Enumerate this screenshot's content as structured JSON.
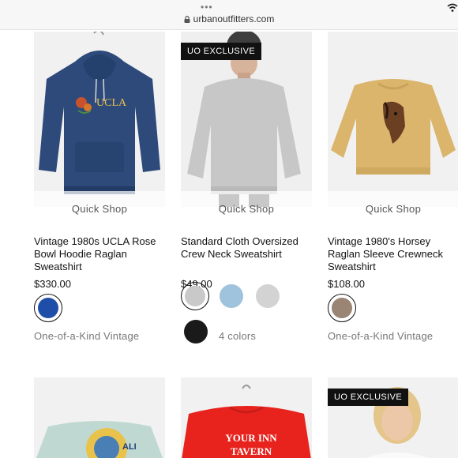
{
  "browser": {
    "dots": "•••",
    "url": "urbanoutfitters.com"
  },
  "products": [
    {
      "title": "Vintage 1980s UCLA Rose Bowl Hoodie Raglan Sweatshirt",
      "price": "$330.00",
      "quick_shop": "Quick Shop",
      "badge": "",
      "print_text": "UCLA",
      "swatches": [
        "#1f4ea8"
      ],
      "meta": "One-of-a-Kind Vintage"
    },
    {
      "title": "Standard Cloth Oversized Crew Neck Sweatshirt",
      "price": "$49.00",
      "quick_shop": "Quick Shop",
      "badge": "UO EXCLUSIVE",
      "swatches": [
        "#c9c9c9",
        "#9fc2dd",
        "#d3d3d3",
        "#1a1a1a"
      ],
      "meta": "4 colors"
    },
    {
      "title": "Vintage 1980's Horsey Raglan Sleeve Crewneck Sweatshirt",
      "price": "$108.00",
      "quick_shop": "Quick Shop",
      "badge": "",
      "swatches": [
        "#9a8473"
      ],
      "meta": "One-of-a-Kind Vintage"
    }
  ],
  "row2": [
    {
      "badge": "",
      "print_text": "ALI"
    },
    {
      "badge": "",
      "print_text": "YOUR INN TAVERN"
    },
    {
      "badge": "UO EXCLUSIVE"
    }
  ]
}
